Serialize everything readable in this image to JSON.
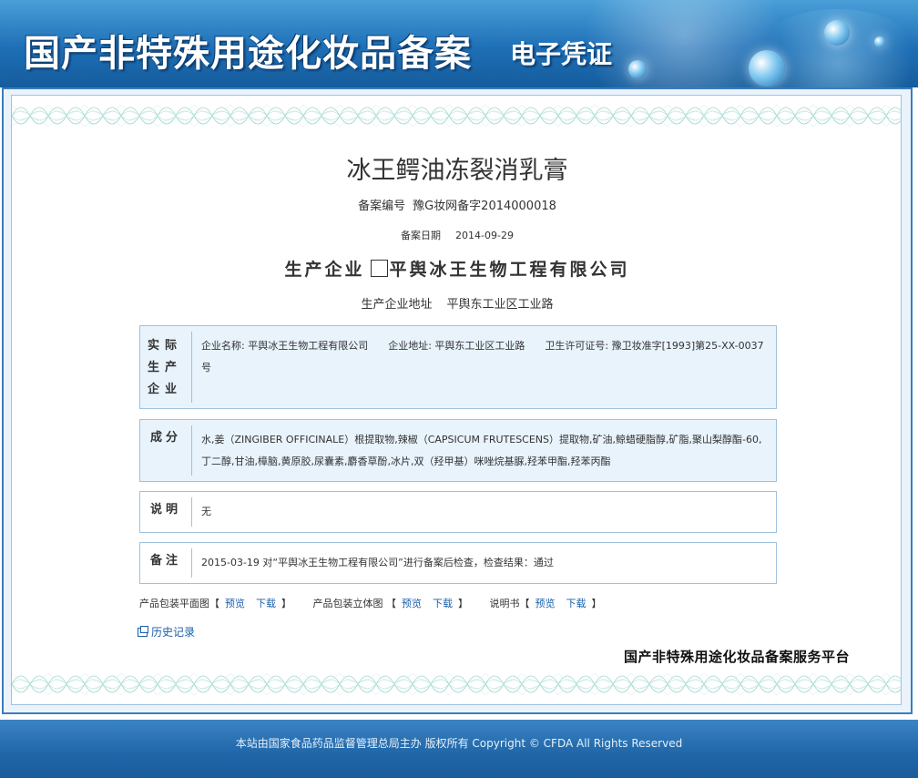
{
  "header": {
    "title_main": "国产非特殊用途化妆品备案",
    "title_sub": "电子凭证"
  },
  "product": {
    "name": "冰王鳄油冻裂消乳膏",
    "record_no_label": "备案编号",
    "record_no": "豫G妆网备字2014000018",
    "record_date_label": "备案日期",
    "record_date": "2014-09-29",
    "producer_label": "生产企业",
    "producer": "平舆冰王生物工程有限公司",
    "producer_addr_label": "生产企业地址",
    "producer_addr": "平舆东工业区工业路"
  },
  "sections": {
    "actual_producer": {
      "label": "实际生产企业",
      "name": "企业名称: 平舆冰王生物工程有限公司",
      "addr": "企业地址: 平舆东工业区工业路",
      "license": "卫生许可证号: 豫卫妆准字[1993]第25-XX-0037号"
    },
    "ingredients": {
      "label": "成分",
      "text": "水,姜（ZINGIBER OFFICINALE）根提取物,辣椒（CAPSICUM FRUTESCENS）提取物,矿油,鲸蜡硬脂醇,矿脂,聚山梨醇酯-60,丁二醇,甘油,樟脑,黄原胶,尿囊素,麝香草酚,冰片,双（羟甲基）咪唑烷基脲,羟苯甲酯,羟苯丙酯"
    },
    "note": {
      "label": "说明",
      "text": "无"
    },
    "remark": {
      "label": "备注",
      "text": "2015-03-19 对“平舆冰王生物工程有限公司”进行备案后检查，检查结果：通过"
    }
  },
  "links": {
    "flat_label": "产品包装平面图【",
    "solid_label": "产品包装立体图 【",
    "manual_label": "说明书【",
    "close": "】",
    "preview": "预览",
    "download": "下载"
  },
  "history": "历史记录",
  "platform": "国产非特殊用途化妆品备案服务平台",
  "footer": {
    "copyright": "本站由国家食品药品监督管理总局主办 版权所有 Copyright © CFDA All Rights Reserved"
  }
}
